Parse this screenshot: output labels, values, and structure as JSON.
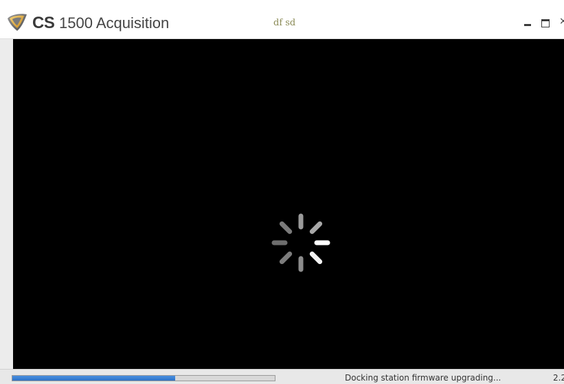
{
  "window": {
    "title_brand": "CS",
    "title_rest": "1500 Acquisition",
    "title_center": "df sd",
    "controls": {
      "minimize_icon": "minimize-icon",
      "maximize_icon": "maximize-icon",
      "close_icon": "close-icon",
      "close_glyph": "×"
    }
  },
  "viewport": {
    "background": "#000000",
    "loading_icon": "loading-spinner-icon"
  },
  "statusbar": {
    "progress": 0.62,
    "progress_color": "#2f73c8",
    "message": "Docking station firmware upgrading...",
    "version": "2.2"
  }
}
